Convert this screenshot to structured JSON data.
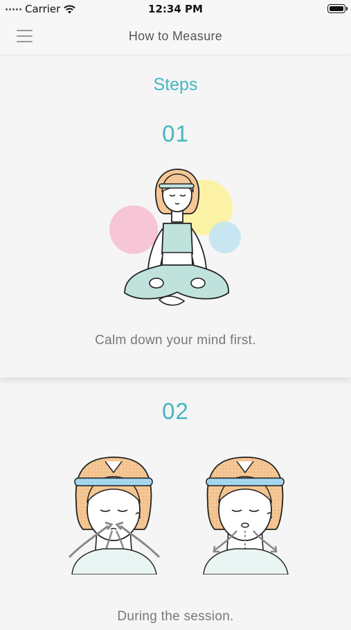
{
  "status_bar": {
    "carrier": "Carrier",
    "time": "12:34 PM"
  },
  "nav": {
    "title": "How to Measure"
  },
  "page": {
    "heading": "Steps"
  },
  "steps": [
    {
      "number": "01",
      "caption": "Calm down your mind first."
    },
    {
      "number": "02",
      "caption": "During the session."
    }
  ],
  "colors": {
    "accent": "#45b7bf",
    "pink": "#f6c6d6",
    "yellow": "#fbf2a6",
    "blue": "#c3e4f2",
    "teal": "#bfe3dc",
    "hair": "#f5c796"
  }
}
